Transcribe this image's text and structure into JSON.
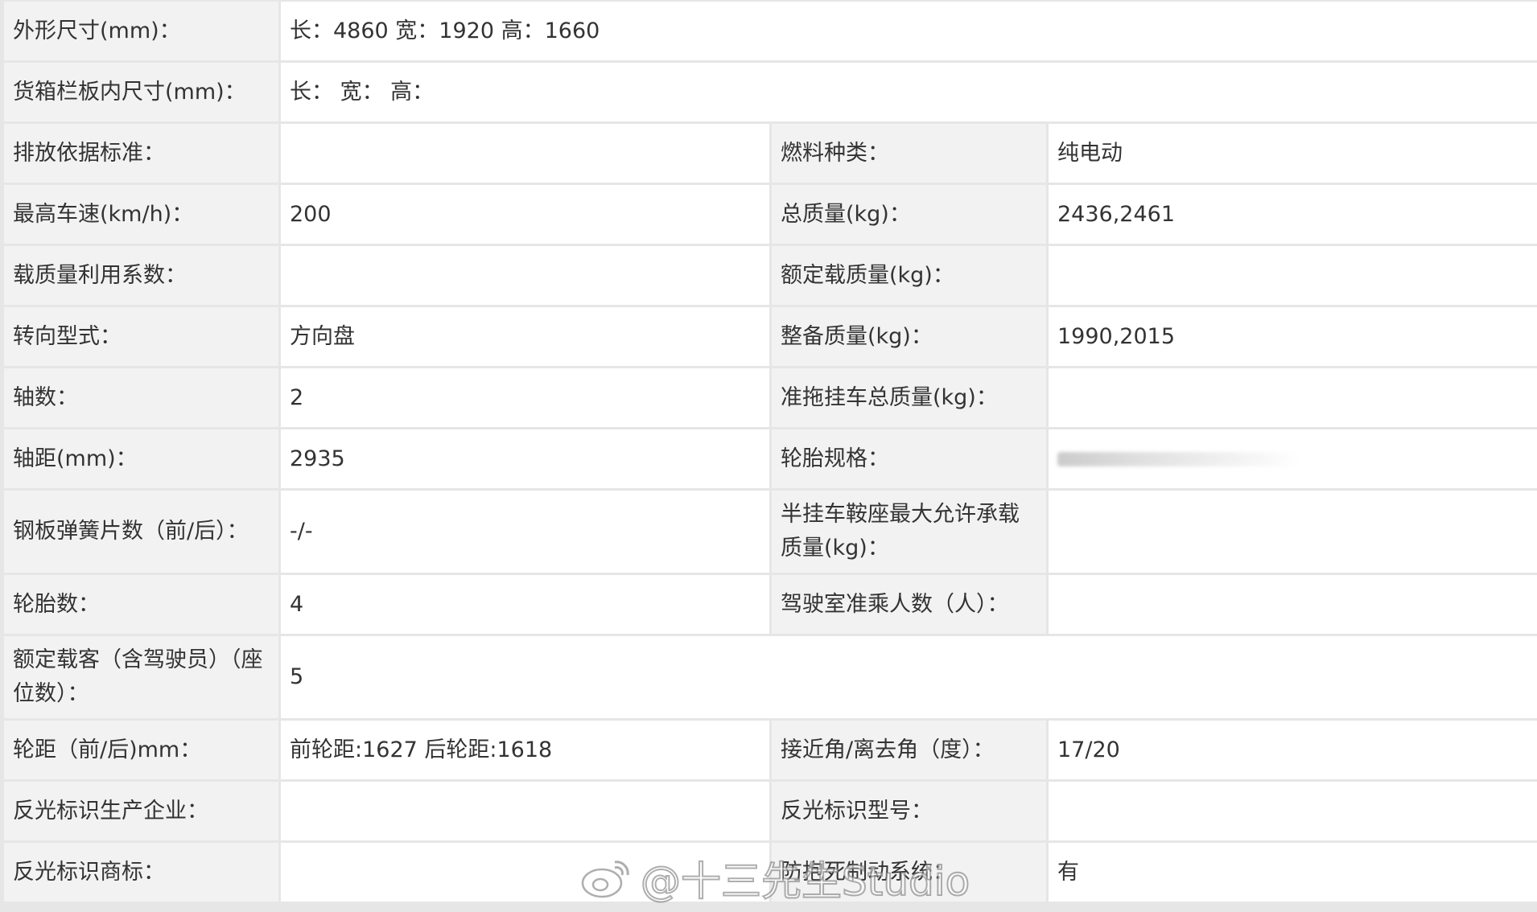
{
  "rows": [
    {
      "label": "外形尺寸(mm)：",
      "value": "长：4860 宽：1920 高：1660"
    },
    {
      "label": "货箱栏板内尺寸(mm)：",
      "value": "长：  宽：  高："
    },
    {
      "label": "排放依据标准：",
      "value": "",
      "label2": "燃料种类：",
      "value2": "纯电动"
    },
    {
      "label": "最高车速(km/h)：",
      "value": "200",
      "label2": "总质量(kg)：",
      "value2": "2436,2461"
    },
    {
      "label": "载质量利用系数：",
      "value": "",
      "label2": "额定载质量(kg)：",
      "value2": ""
    },
    {
      "label": "转向型式：",
      "value": "方向盘",
      "label2": "整备质量(kg)：",
      "value2": "1990,2015"
    },
    {
      "label": "轴数：",
      "value": "2",
      "label2": "准拖挂车总质量(kg)：",
      "value2": ""
    },
    {
      "label": "轴距(mm)：",
      "value": "2935",
      "label2": "轮胎规格：",
      "value2": ""
    },
    {
      "label": "钢板弹簧片数（前/后）：",
      "value": "-/-",
      "label2": "半挂车鞍座最大允许承载质量(kg)：",
      "value2": ""
    },
    {
      "label": "轮胎数：",
      "value": "4",
      "label2": "驾驶室准乘人数（人）：",
      "value2": ""
    },
    {
      "label": "额定载客（含驾驶员）（座位数）：",
      "value": "5"
    },
    {
      "label": "轮距（前/后)mm：",
      "value": "前轮距:1627 后轮距:1618",
      "label2": "接近角/离去角（度）：",
      "value2": "17/20"
    },
    {
      "label": "反光标识生产企业：",
      "value": "",
      "label2": "反光标识型号：",
      "value2": ""
    },
    {
      "label": "反光标识商标：",
      "value": "",
      "label2": "防抱死制动系统：",
      "value2": "有"
    }
  ],
  "watermark": {
    "text": "@十三先生Studio",
    "icon": "weibo-icon"
  }
}
